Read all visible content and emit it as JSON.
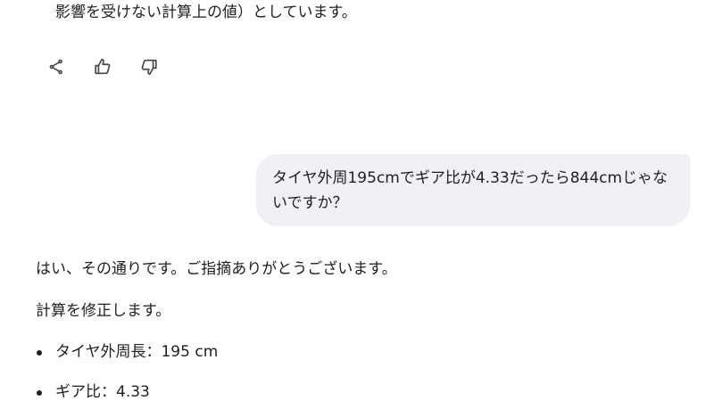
{
  "previous_response": {
    "tail_text": "影響を受けない計算上の値）としています。"
  },
  "actions": [
    {
      "icon": "share-icon",
      "label": "share"
    },
    {
      "icon": "thumbs-up-icon",
      "label": "good response"
    },
    {
      "icon": "thumbs-down-icon",
      "label": "bad response"
    }
  ],
  "user_message": {
    "text": "タイヤ外周195cmでギア比が4.33だったら844cmじゃないですか？"
  },
  "answer": {
    "paragraph_1": "はい、その通りです。ご指摘ありがとうございます。",
    "paragraph_2": "計算を修正します。",
    "bullets": [
      "タイヤ外周長：195 cm",
      "ギア比：4.33"
    ]
  }
}
